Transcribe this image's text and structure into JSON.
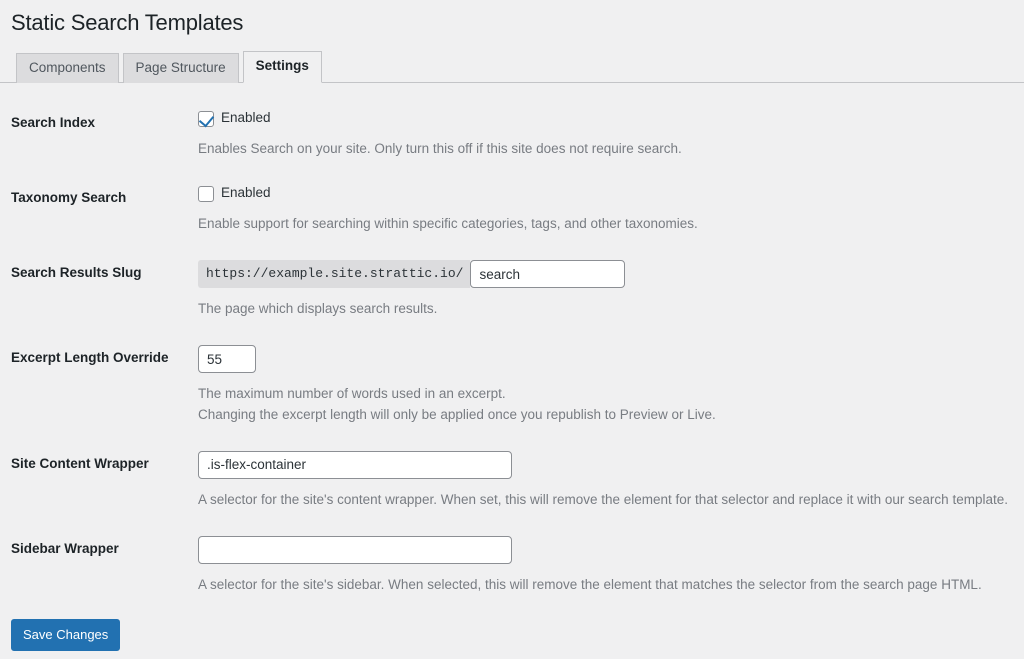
{
  "page": {
    "title": "Static Search Templates"
  },
  "tabs": [
    {
      "label": "Components",
      "active": false
    },
    {
      "label": "Page Structure",
      "active": false
    },
    {
      "label": "Settings",
      "active": true
    }
  ],
  "settings": {
    "search_index": {
      "label": "Search Index",
      "checkbox_label": "Enabled",
      "checked": true,
      "description": "Enables Search on your site. Only turn this off if this site does not require search."
    },
    "taxonomy_search": {
      "label": "Taxonomy Search",
      "checkbox_label": "Enabled",
      "checked": false,
      "description": "Enable support for searching within specific categories, tags, and other taxonomies."
    },
    "search_results_slug": {
      "label": "Search Results Slug",
      "url_prefix": "https://example.site.strattic.io/",
      "value": "search",
      "placeholder": "",
      "description": "The page which displays search results."
    },
    "excerpt_length_override": {
      "label": "Excerpt Length Override",
      "value": "55",
      "placeholder": "",
      "description_line_1": "The maximum number of words used in an excerpt.",
      "description_line_2": "Changing the excerpt length will only be applied once you republish to Preview or Live."
    },
    "site_content_wrapper": {
      "label": "Site Content Wrapper",
      "value": ".is-flex-container",
      "placeholder": "",
      "description": "A selector for the site's content wrapper. When set, this will remove the element for that selector and replace it with our search template."
    },
    "sidebar_wrapper": {
      "label": "Sidebar Wrapper",
      "value": "",
      "placeholder": "",
      "description": "A selector for the site's sidebar. When selected, this will remove the element that matches the selector from the search page HTML."
    }
  },
  "submit": {
    "save_label": "Save Changes"
  },
  "colors": {
    "page_background": "#f0f0f1",
    "accent_blue": "#2271b1",
    "tab_inactive": "#dcdcde",
    "border": "#c3c4c7",
    "text": "#1d2327",
    "description_text": "#787c82"
  }
}
